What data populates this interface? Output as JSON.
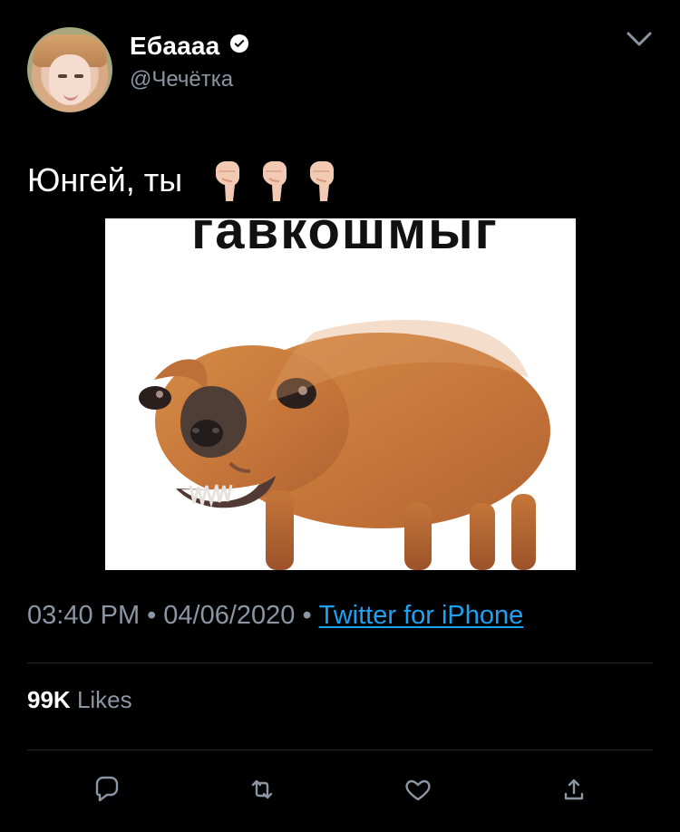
{
  "tweet": {
    "display_name": "Ебаааа",
    "handle": "@Чечётка",
    "text": "Юнгей, ты",
    "emoji": "👇👇👇",
    "image_caption": "гавкошмыг",
    "time": "03:40 PM",
    "date": "04/06/2020",
    "source": "Twitter for iPhone",
    "likes_count": "99K",
    "likes_label": "Likes"
  },
  "icons": {
    "verified": "verified-badge-icon",
    "menu": "chevron-down-icon",
    "reply": "reply-icon",
    "retweet": "retweet-icon",
    "like": "heart-icon",
    "share": "share-icon"
  },
  "colors": {
    "background": "#000000",
    "primary_text": "#ffffff",
    "secondary_text": "#8b96a4",
    "link": "#1da1f2",
    "divider": "#1f2933"
  }
}
